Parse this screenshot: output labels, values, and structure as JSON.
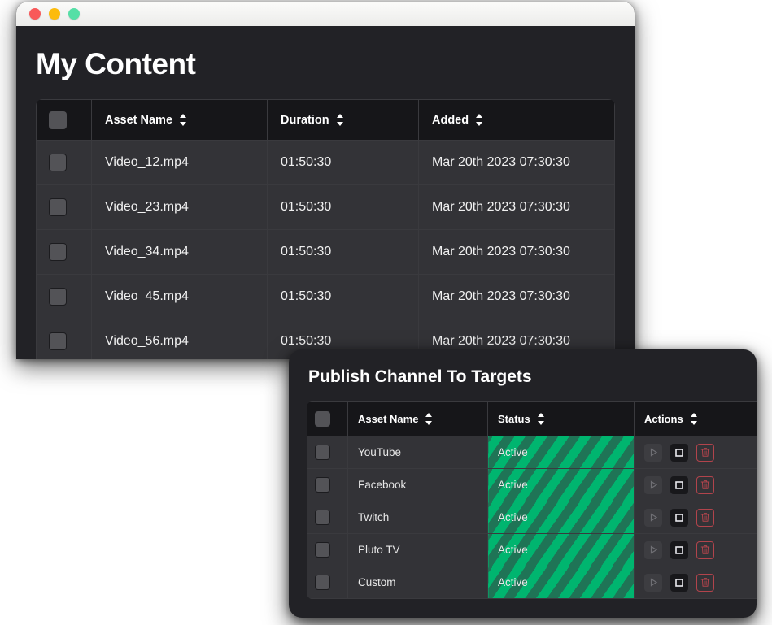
{
  "window": {
    "traffic_lights": [
      {
        "name": "close",
        "color": "#f8595a"
      },
      {
        "name": "minimize",
        "color": "#fcbb0c"
      },
      {
        "name": "maximize",
        "color": "#55dfa6"
      }
    ],
    "title": "My Content"
  },
  "content_table": {
    "columns": [
      {
        "id": "select",
        "label": "",
        "sortable": false
      },
      {
        "id": "asset_name",
        "label": "Asset Name",
        "sortable": true
      },
      {
        "id": "duration",
        "label": "Duration",
        "sortable": true
      },
      {
        "id": "added",
        "label": "Added",
        "sortable": true
      }
    ],
    "rows": [
      {
        "asset_name": "Video_12.mp4",
        "duration": "01:50:30",
        "added": "Mar 20th 2023 07:30:30"
      },
      {
        "asset_name": "Video_23.mp4",
        "duration": "01:50:30",
        "added": "Mar 20th 2023 07:30:30"
      },
      {
        "asset_name": "Video_34.mp4",
        "duration": "01:50:30",
        "added": "Mar 20th 2023 07:30:30"
      },
      {
        "asset_name": "Video_45.mp4",
        "duration": "01:50:30",
        "added": "Mar 20th 2023 07:30:30"
      },
      {
        "asset_name": "Video_56.mp4",
        "duration": "01:50:30",
        "added": "Mar 20th 2023 07:30:30"
      }
    ]
  },
  "publish_panel": {
    "title": "Publish Channel To Targets",
    "columns": [
      {
        "id": "select",
        "label": "",
        "sortable": false
      },
      {
        "id": "asset_name",
        "label": "Asset Name",
        "sortable": true
      },
      {
        "id": "status",
        "label": "Status",
        "sortable": true
      },
      {
        "id": "actions",
        "label": "Actions",
        "sortable": true
      }
    ],
    "rows": [
      {
        "asset_name": "YouTube",
        "status": "Active"
      },
      {
        "asset_name": "Facebook",
        "status": "Active"
      },
      {
        "asset_name": "Twitch",
        "status": "Active"
      },
      {
        "asset_name": "Pluto TV",
        "status": "Active"
      },
      {
        "asset_name": "Custom",
        "status": "Active"
      }
    ],
    "actions": [
      {
        "id": "play",
        "icon": "play-icon"
      },
      {
        "id": "stop",
        "icon": "stop-icon"
      },
      {
        "id": "delete",
        "icon": "trash-icon"
      }
    ]
  },
  "colors": {
    "page_bg": "#222226",
    "row_bg": "#333337",
    "header_bg": "#161619",
    "status_stripe_light": "#00b56f",
    "status_stripe_dark": "#1f7456",
    "delete_red": "#b2444c"
  }
}
